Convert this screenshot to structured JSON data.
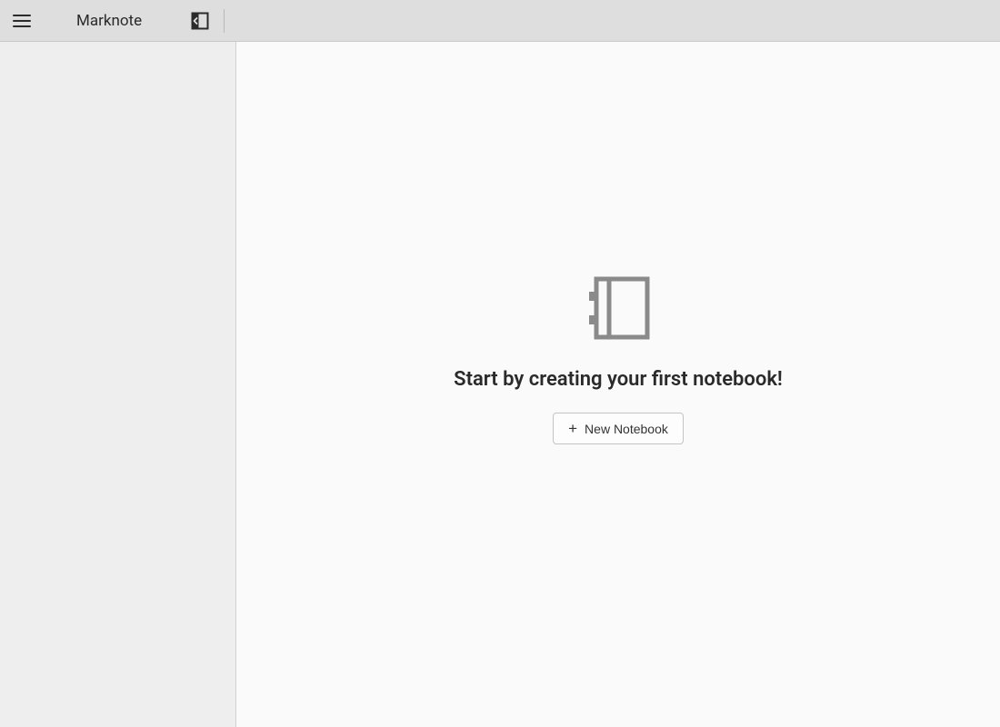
{
  "header": {
    "app_title": "Marknote"
  },
  "main": {
    "empty_message": "Start by creating your first notebook!",
    "new_notebook_label": "New Notebook"
  }
}
